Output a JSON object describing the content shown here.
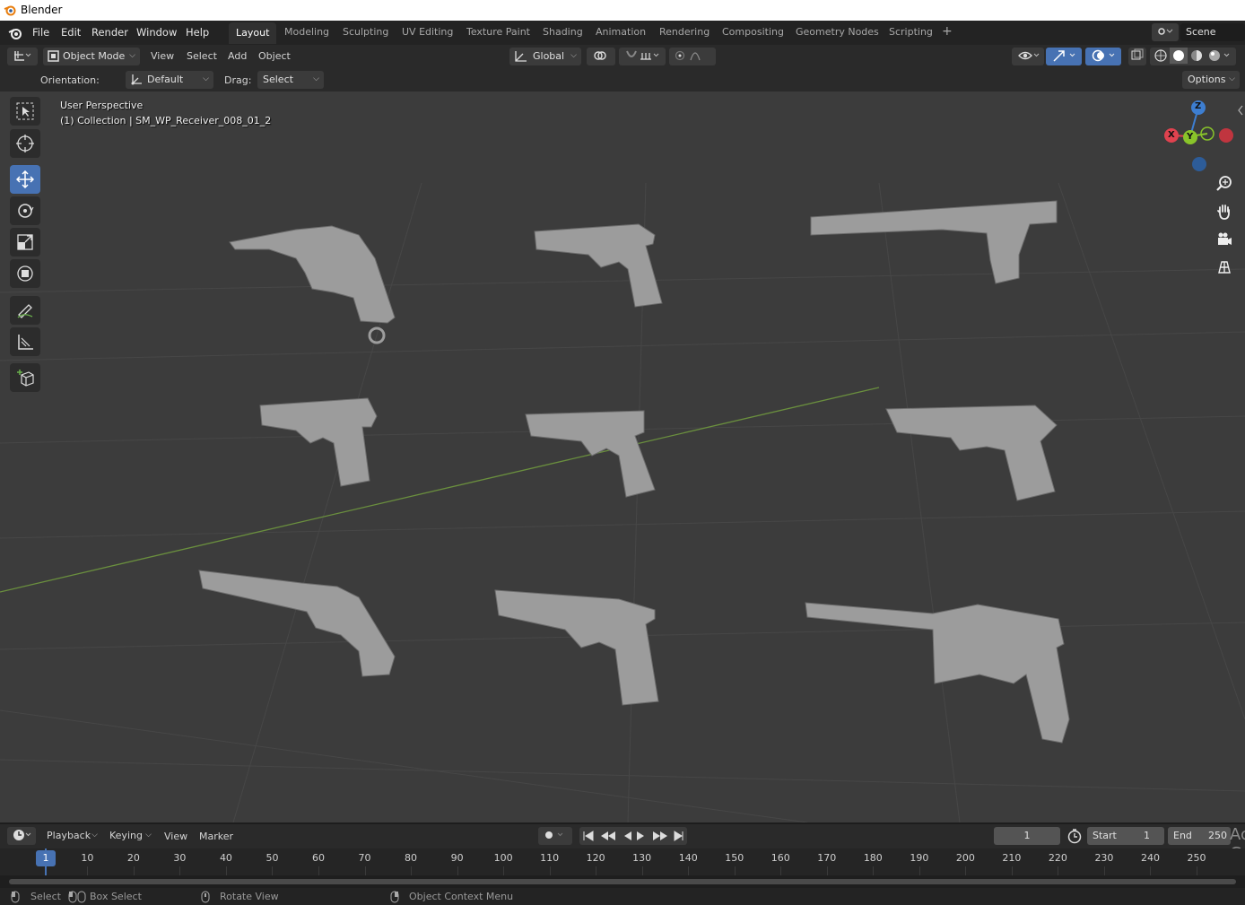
{
  "app": {
    "title": "Blender"
  },
  "menu": [
    "File",
    "Edit",
    "Render",
    "Window",
    "Help"
  ],
  "workspaces": [
    "Layout",
    "Modeling",
    "Sculpting",
    "UV Editing",
    "Texture Paint",
    "Shading",
    "Animation",
    "Rendering",
    "Compositing",
    "Geometry Nodes",
    "Scripting"
  ],
  "active_workspace": "Layout",
  "scene": {
    "name": "Scene"
  },
  "header": {
    "mode": "Object Mode",
    "menus": [
      "View",
      "Select",
      "Add",
      "Object"
    ],
    "transform_orientation": "Global"
  },
  "tool_settings": {
    "orientation_label": "Orientation:",
    "orientation_value": "Default",
    "drag_label": "Drag:",
    "drag_value": "Select Box",
    "options": "Options"
  },
  "viewport": {
    "perspective": "User Perspective",
    "collection": "(1) Collection | SM_WP_Receiver_008_01_2"
  },
  "gizmo": {
    "x": "X",
    "y": "Y",
    "z": "Z"
  },
  "timeline": {
    "menus": [
      "Playback",
      "Keying",
      "View",
      "Marker"
    ],
    "current_frame": "1",
    "start_label": "Start",
    "start": "1",
    "end_label": "End",
    "end": "250",
    "ticks": [
      "1",
      "10",
      "20",
      "30",
      "40",
      "50",
      "60",
      "70",
      "80",
      "90",
      "100",
      "110",
      "120",
      "130",
      "140",
      "150",
      "160",
      "170",
      "180",
      "190",
      "200",
      "210",
      "220",
      "230",
      "240",
      "250"
    ]
  },
  "status": {
    "select": "Select",
    "box_select": "Box Select",
    "rotate_view": "Rotate View",
    "context_menu": "Object Context Menu"
  },
  "watermark": "Ac Go",
  "colors": {
    "viewport_bg": "#3c3c3c",
    "active_tool": "#4772b3",
    "x_axis": "#e0424f",
    "y_axis": "#89c42a",
    "z_axis": "#3d7ed1",
    "frame_marker": "#4772b3"
  }
}
